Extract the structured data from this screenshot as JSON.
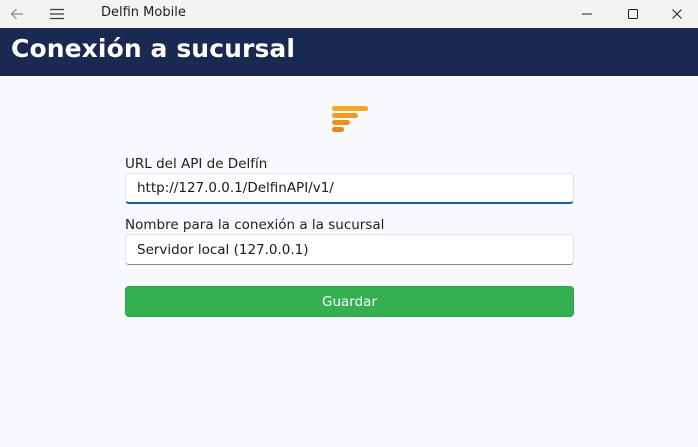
{
  "window": {
    "title": "Delfin Mobile"
  },
  "header": {
    "title": "Conexión a sucursal"
  },
  "form": {
    "url_label": "URL del API de Delfín",
    "url_value": "http://127.0.0.1/DelfinAPI/v1/",
    "name_label": "Nombre para la conexión a la sucursal",
    "name_value": "Servidor local (127.0.0.1)",
    "save_label": "Guardar"
  },
  "colors": {
    "header_bg": "#1a2952",
    "save_button": "#33b04f",
    "logo": "#f29a1f",
    "focus_accent": "#1f5aa6"
  },
  "icons": [
    "back-arrow-icon",
    "hamburger-menu-icon",
    "minimize-icon",
    "maximize-icon",
    "close-icon",
    "delfin-logo"
  ]
}
